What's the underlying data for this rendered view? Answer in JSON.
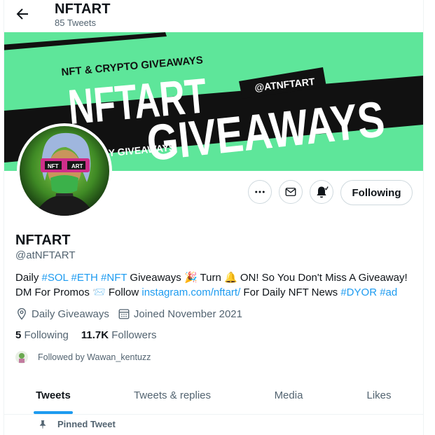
{
  "header": {
    "title": "NFTART",
    "tweet_count": "85 Tweets"
  },
  "banner": {
    "line_small": "NFT & CRYPTO GIVEAWAYS",
    "line_big_1": "NFTART",
    "line_big_2": "GIVEAWAYS",
    "tag_handle": "@ATNFTART",
    "tag_daily": "DAILY GIVEAWAYS",
    "colors": {
      "background": "#5ee69a",
      "stripe": "#111111",
      "text": "#ffffff"
    }
  },
  "avatar": {
    "mask_text": "NFT ART"
  },
  "actions": {
    "more_icon": "more-icon",
    "message_icon": "envelope-icon",
    "notify_icon": "bell-icon",
    "follow_label": "Following"
  },
  "profile": {
    "name": "NFTART",
    "handle": "@atNFTART",
    "bio": {
      "p1": "Daily ",
      "tag_sol": "#SOL",
      "tag_eth": "#ETH",
      "tag_nft": "#NFT",
      "p2": " Giveaways 🎉  Turn 🔔 ON! So You Don't Miss A Giveaway! DM For Promos 📨  Follow ",
      "link_insta": "instagram.com/nftart/",
      "p3": " For Daily NFT News ",
      "tag_dyor": "#DYOR",
      "tag_ad": "#ad"
    },
    "location": "Daily Giveaways",
    "joined": "Joined November 2021",
    "following_count": "5",
    "following_label": "Following",
    "followers_count": "11.7K",
    "followers_label": "Followers",
    "followed_by": "Followed by Wawan_kentuzz"
  },
  "tabs": [
    {
      "label": "Tweets"
    },
    {
      "label": "Tweets & replies"
    },
    {
      "label": "Media"
    },
    {
      "label": "Likes"
    }
  ],
  "pinned_label": "Pinned Tweet",
  "colors": {
    "accent": "#1d9bf0",
    "text_secondary": "#536471"
  }
}
